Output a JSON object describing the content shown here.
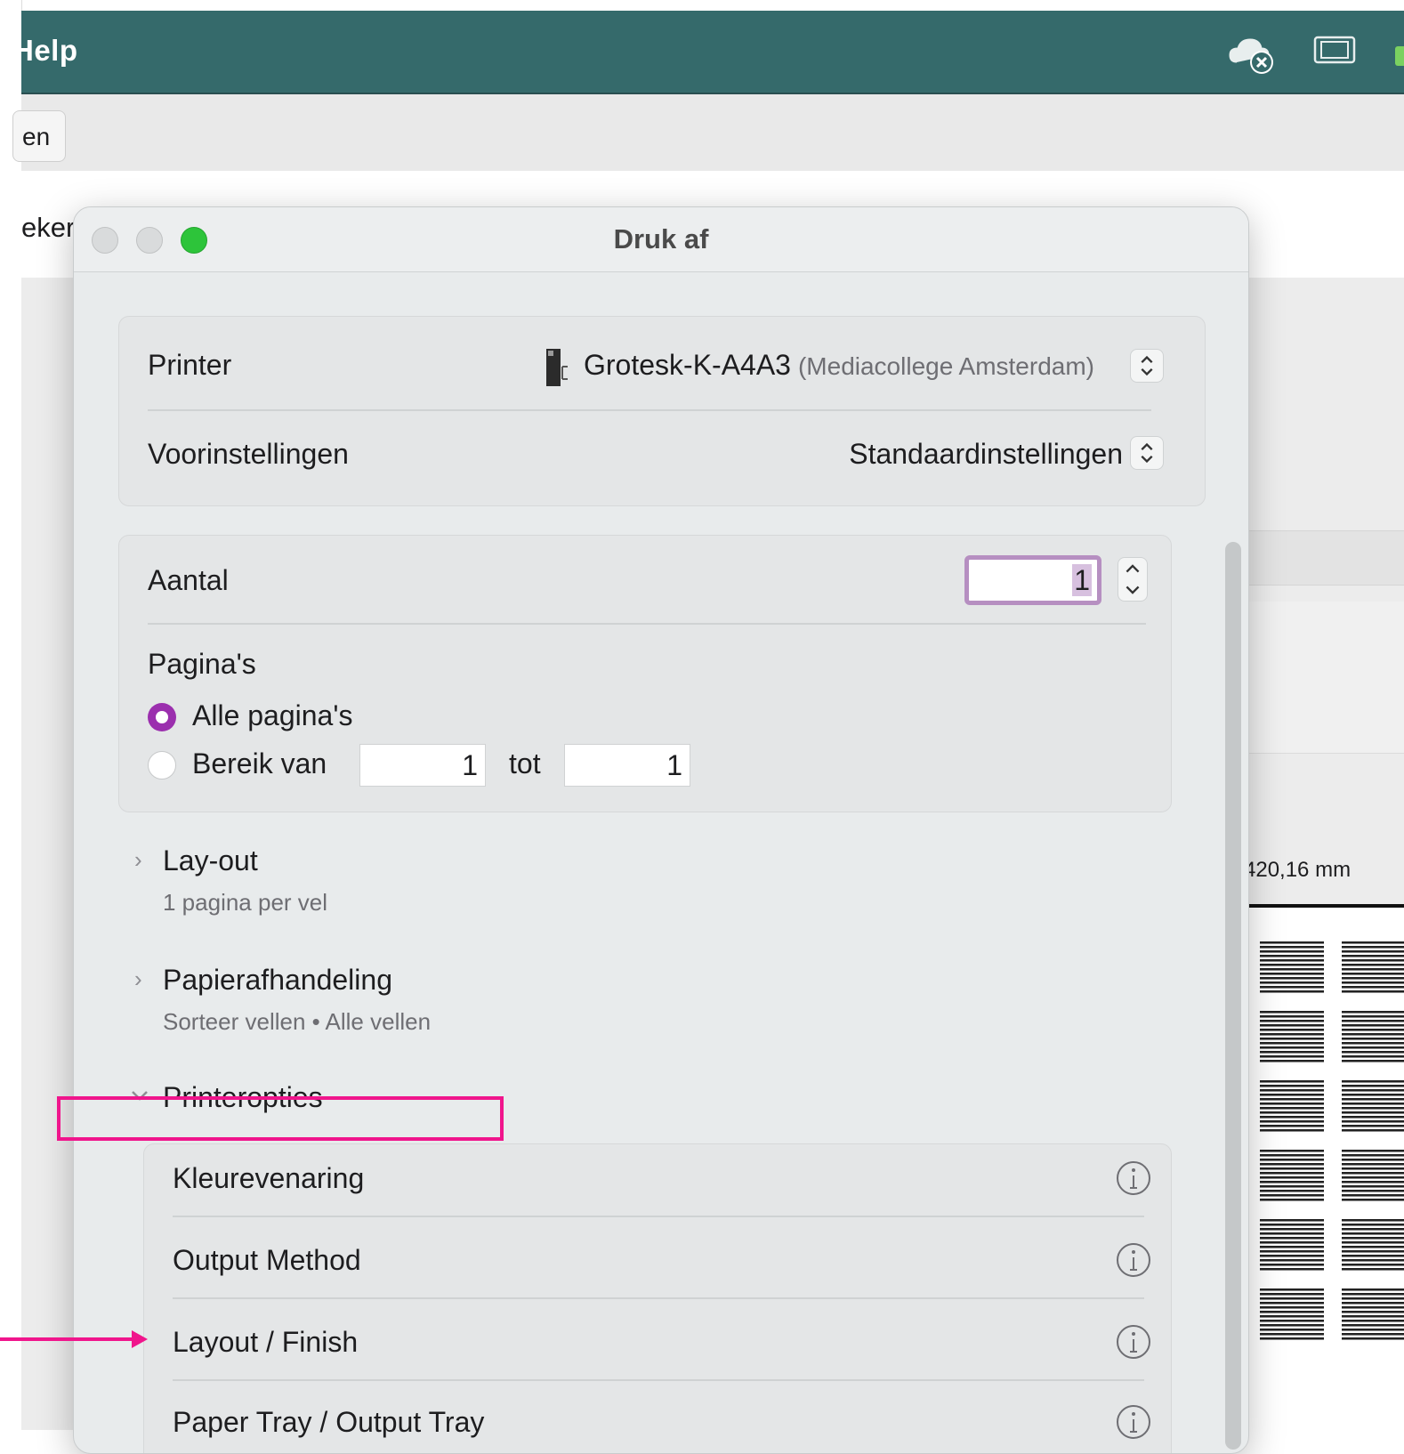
{
  "app": {
    "menu_help": "Help",
    "toolbar_button": "en",
    "sub_label": "eker",
    "dimension_text": "420,16 mm"
  },
  "dialog": {
    "title": "Druk af",
    "printer_label": "Printer",
    "printer_name": "Grotesk-K-A4A3",
    "printer_location": "(Mediacollege Amsterdam)",
    "presets_label": "Voorinstellingen",
    "presets_value": "Standaardinstellingen",
    "copies_label": "Aantal",
    "copies_value": "1",
    "pages_label": "Pagina's",
    "all_pages_label": "Alle pagina's",
    "range_label": "Bereik van",
    "range_from": "1",
    "range_to_label": "tot",
    "range_to": "1",
    "sections": [
      {
        "title": "Lay-out",
        "subtitle": "1 pagina per vel"
      },
      {
        "title": "Papierafhandeling",
        "subtitle": "Sorteer vellen • Alle vellen"
      },
      {
        "title": "Printeropties",
        "subtitle": ""
      }
    ],
    "printer_options": [
      {
        "label": "Kleurevenaring"
      },
      {
        "label": "Output Method"
      },
      {
        "label": "Layout / Finish"
      },
      {
        "label": "Paper Tray / Output Tray"
      }
    ]
  },
  "colors": {
    "topbar": "#356a6b",
    "accent_radio": "#9b2fae",
    "annotation": "#f0158c",
    "zoom_button": "#2dc43a"
  }
}
